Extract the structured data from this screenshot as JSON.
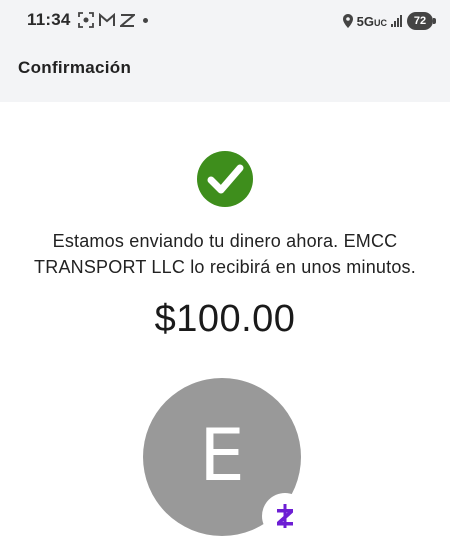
{
  "status_bar": {
    "time": "11:34",
    "network": "5G",
    "network_sub": "UC",
    "battery": "72"
  },
  "header": {
    "title": "Confirmación"
  },
  "confirmation": {
    "message": "Estamos enviando tu dinero ahora. EMCC TRANSPORT LLC lo recibirá en unos minutos.",
    "amount": "$100.00",
    "avatar_initial": "E"
  },
  "colors": {
    "success": "#3e8e1c",
    "zelle_purple": "#6d1ed4",
    "avatar_bg": "#999999",
    "header_bg": "#f3f4f6"
  },
  "icons": {
    "success": "check-circle-icon",
    "badge": "zelle-logo-icon"
  }
}
